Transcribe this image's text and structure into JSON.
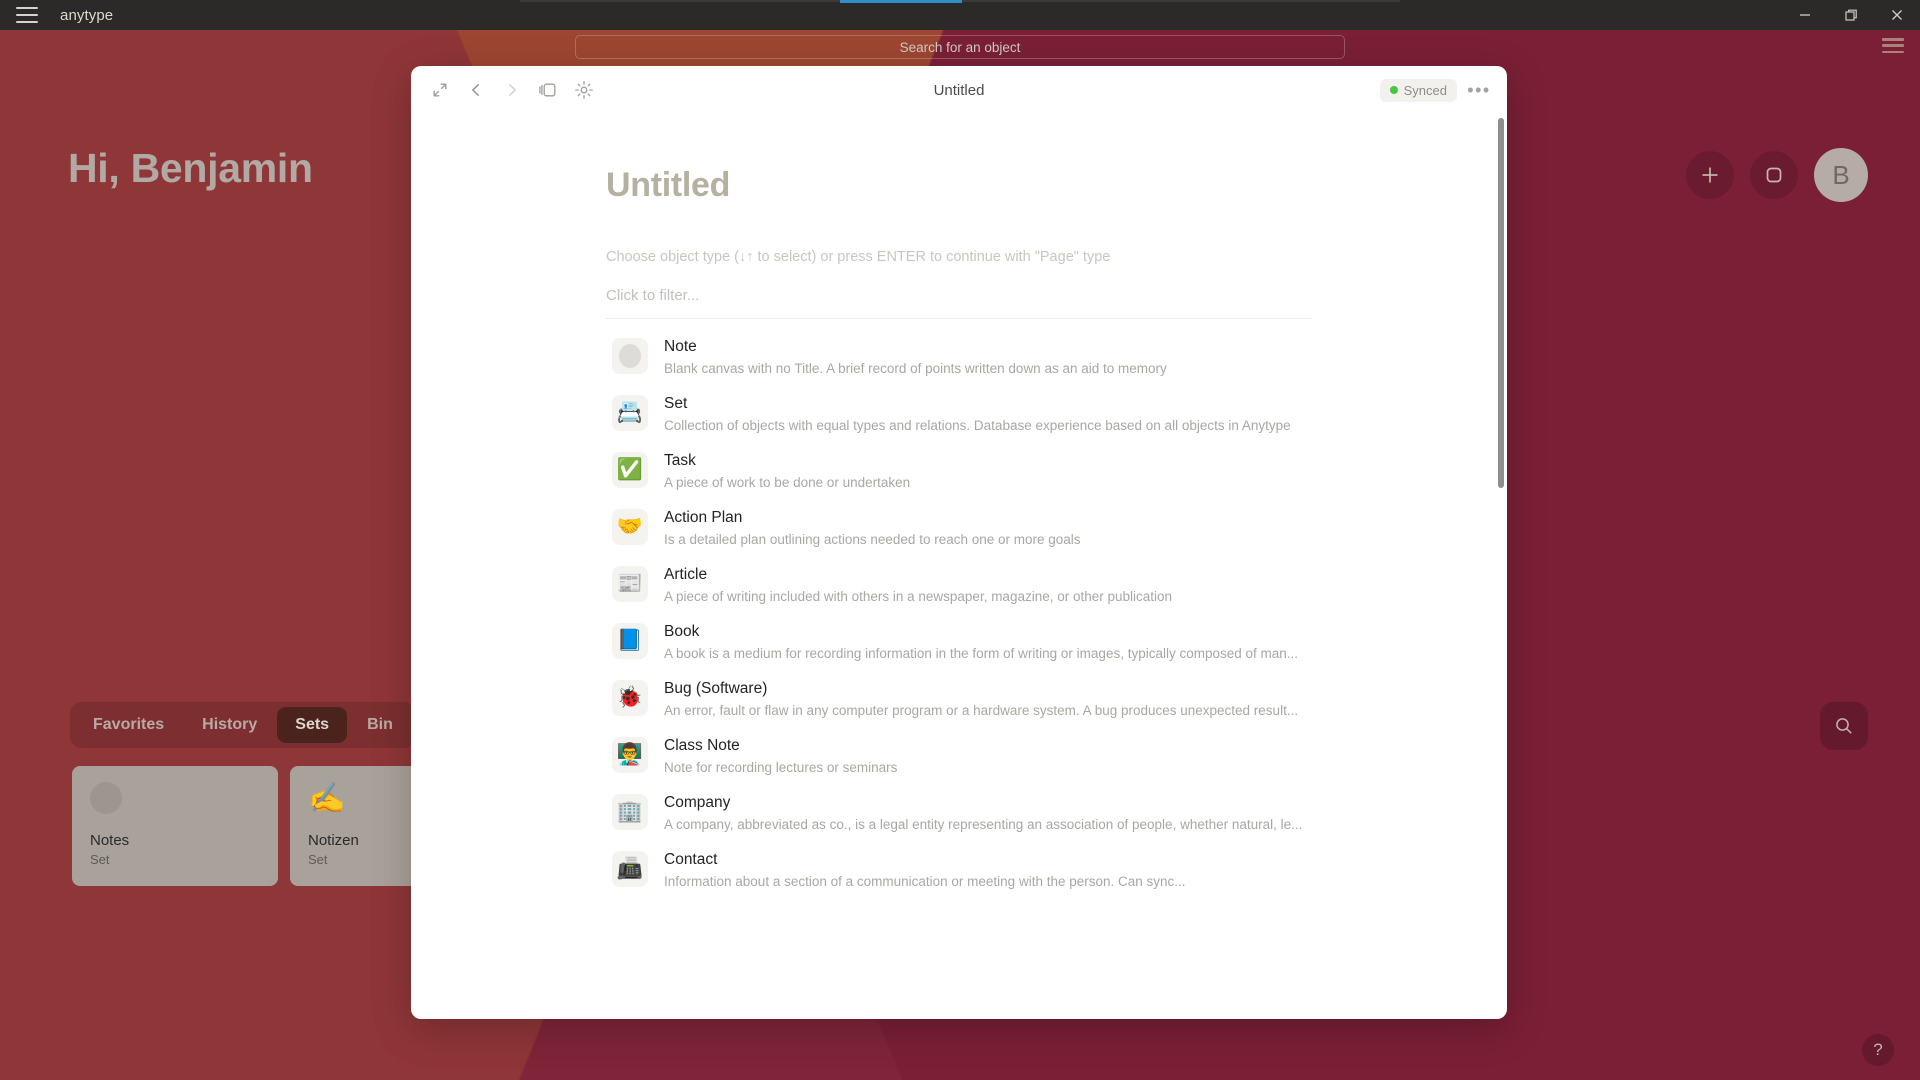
{
  "titlebar": {
    "app_name": "anytype",
    "menu_icon": "hamburger-icon",
    "minimize_label": "–",
    "maximize_label": "❐",
    "close_label": "✕"
  },
  "appbar": {
    "search_placeholder": "Search for an object",
    "menu_icon": "hamburger-icon"
  },
  "home": {
    "greeting": "Hi, Benjamin",
    "add_button_label": "+",
    "new_object_button_label": "new-object",
    "avatar_initial": "B",
    "tabs": [
      {
        "label": "Favorites",
        "active": false
      },
      {
        "label": "History",
        "active": false
      },
      {
        "label": "Sets",
        "active": true
      },
      {
        "label": "Bin",
        "active": false
      }
    ],
    "cards": [
      {
        "icon": "blank-circle",
        "title": "Notes",
        "subtitle": "Set"
      },
      {
        "icon": "✍️",
        "title": "Notizen",
        "subtitle": "Set"
      }
    ],
    "search_fab_icon": "search-icon",
    "help_button_label": "?"
  },
  "modal": {
    "title": "Untitled",
    "nav": {
      "expand_icon": "expand-icon",
      "back_icon": "chevron-left-icon",
      "forward_icon": "chevron-right-icon",
      "sidebar_icon": "sidebar-toggle-icon",
      "widgets_icon": "sun-burst-icon"
    },
    "sync_status": "Synced",
    "sync_color": "#3fca3f",
    "more_label": "•••",
    "doc_title": "Untitled",
    "choose_hint": "Choose object type (↓↑ to select) or press ENTER to continue with \"Page\" type",
    "filter_placeholder": "Click to filter...",
    "types": [
      {
        "icon": "blank-circle",
        "name": "Note",
        "desc": "Blank canvas with no Title. A brief record of points written down as an aid to memory"
      },
      {
        "icon": "📇",
        "name": "Set",
        "desc": "Collection of objects with equal types and relations. Database experience based on all objects in Anytype"
      },
      {
        "icon": "✅",
        "name": "Task",
        "desc": "A piece of work to be done or undertaken"
      },
      {
        "icon": "🤝",
        "name": "Action Plan",
        "desc": "Is a detailed plan outlining actions needed to reach one or more goals"
      },
      {
        "icon": "📰",
        "name": "Article",
        "desc": "A piece of writing included with others in a newspaper, magazine, or other publication"
      },
      {
        "icon": "📘",
        "name": "Book",
        "desc": "A book is a medium for recording information in the form of writing or images, typically composed of man..."
      },
      {
        "icon": "🐞",
        "name": "Bug (Software)",
        "desc": "An error, fault or flaw in any computer program or a hardware system. A bug produces unexpected result..."
      },
      {
        "icon": "👨‍🏫",
        "name": "Class Note",
        "desc": "Note for recording lectures or seminars"
      },
      {
        "icon": "🏢",
        "name": "Company",
        "desc": "A company, abbreviated as co., is a legal entity representing an association of people, whether natural, le..."
      },
      {
        "icon": "📠",
        "name": "Contact",
        "desc": "Information about a section of a communication or meeting with the person. Can sync..."
      }
    ]
  },
  "colors": {
    "desktop_base": "#9d4632",
    "desktop_dark": "#7a1f36",
    "titlebar": "#2b2a28",
    "tab_accent": "#2d8fc8",
    "card_bg": "#a8a29a",
    "active_tab_bg": "#4a241c"
  }
}
